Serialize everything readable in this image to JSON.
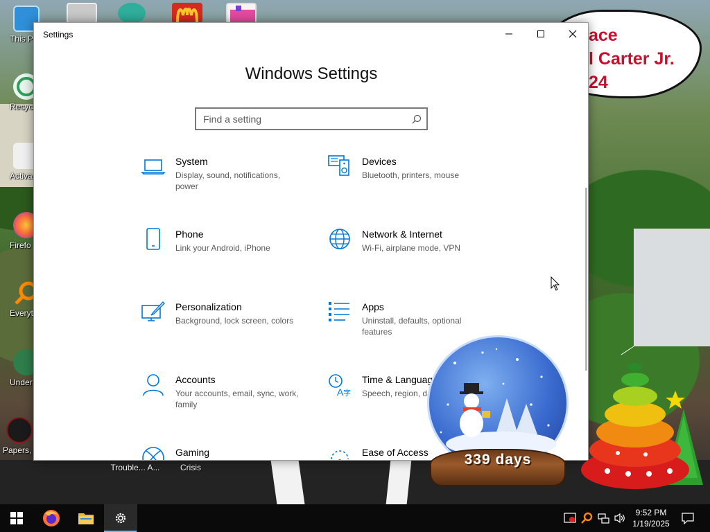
{
  "desktop": {
    "icons": [
      {
        "label": "This P"
      },
      {
        "label": "Recycle"
      },
      {
        "label": "Activa"
      },
      {
        "label": "Firefo"
      },
      {
        "label": "Everyth"
      },
      {
        "label": "Under"
      },
      {
        "label": "Papers, P"
      }
    ],
    "speech_lines": [
      "ace",
      "l Carter Jr.",
      "24"
    ],
    "widget_labels": [
      "Trouble... A...",
      "Crisis"
    ],
    "countdown": "339 days"
  },
  "window": {
    "title": "Settings",
    "heading": "Windows Settings",
    "search_placeholder": "Find a setting",
    "tiles": [
      {
        "name": "System",
        "desc": "Display, sound, notifications, power",
        "icon": "laptop-icon"
      },
      {
        "name": "Devices",
        "desc": "Bluetooth, printers, mouse",
        "icon": "devices-icon"
      },
      {
        "name": "Phone",
        "desc": "Link your Android, iPhone",
        "icon": "phone-icon"
      },
      {
        "name": "Network & Internet",
        "desc": "Wi-Fi, airplane mode, VPN",
        "icon": "globe-icon"
      },
      {
        "name": "Personalization",
        "desc": "Background, lock screen, colors",
        "icon": "paintbrush-icon"
      },
      {
        "name": "Apps",
        "desc": "Uninstall, defaults, optional features",
        "icon": "apps-list-icon"
      },
      {
        "name": "Accounts",
        "desc": "Your accounts, email, sync, work, family",
        "icon": "person-icon"
      },
      {
        "name": "Time & Language",
        "desc": "Speech, region, date",
        "icon": "time-language-icon"
      },
      {
        "name": "Gaming",
        "desc": "",
        "icon": "xbox-icon"
      },
      {
        "name": "Ease of Access",
        "desc": "",
        "icon": "ease-of-access-icon"
      }
    ]
  },
  "taskbar": {
    "clock_time": "9:52 PM",
    "clock_date": "1/19/2025"
  },
  "colors": {
    "accent": "#0078d7",
    "taskbar": "#0a0a0a"
  }
}
